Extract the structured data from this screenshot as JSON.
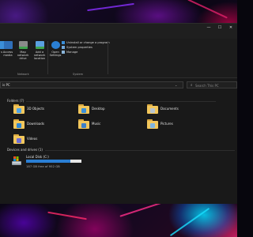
{
  "window": {
    "controls": {
      "minimize": "—",
      "maximize": "☐",
      "close": "✕"
    }
  },
  "ribbon": {
    "buttons": [
      {
        "label": "s"
      },
      {
        "label": "Access\nmedia"
      },
      {
        "label": "Map network\ndrive"
      },
      {
        "label": "Add a network\nlocation"
      },
      {
        "label": "Open\nSettings"
      }
    ],
    "small_items": [
      "Uninstall or change a program",
      "System properties",
      "Manage"
    ],
    "groups": [
      "Network",
      "System"
    ]
  },
  "address": {
    "path": "is PC",
    "search_placeholder": "Search This PC"
  },
  "sections": {
    "folders": "Folders (7)",
    "drives": "Devices and drives (1)"
  },
  "folders": [
    {
      "name": "3D Objects",
      "badge": "#4fa3e8"
    },
    {
      "name": "Desktop",
      "badge": "#3a8fd8"
    },
    {
      "name": "Documents",
      "badge": "#b8c4cf"
    },
    {
      "name": "Downloads",
      "badge": "#2e86d6"
    },
    {
      "name": "Music",
      "badge": "#3d7fc8"
    },
    {
      "name": "Pictures",
      "badge": "#7fb5e0"
    },
    {
      "name": "Videos",
      "badge": "#6d6dd6"
    }
  ],
  "drive": {
    "name": "Local Disk (C:)",
    "free_text": "187 GB free of 952 GB",
    "used_fraction": 0.8
  },
  "colors": {
    "accent": "#2a7fd4",
    "folder": "#f2c75c"
  }
}
